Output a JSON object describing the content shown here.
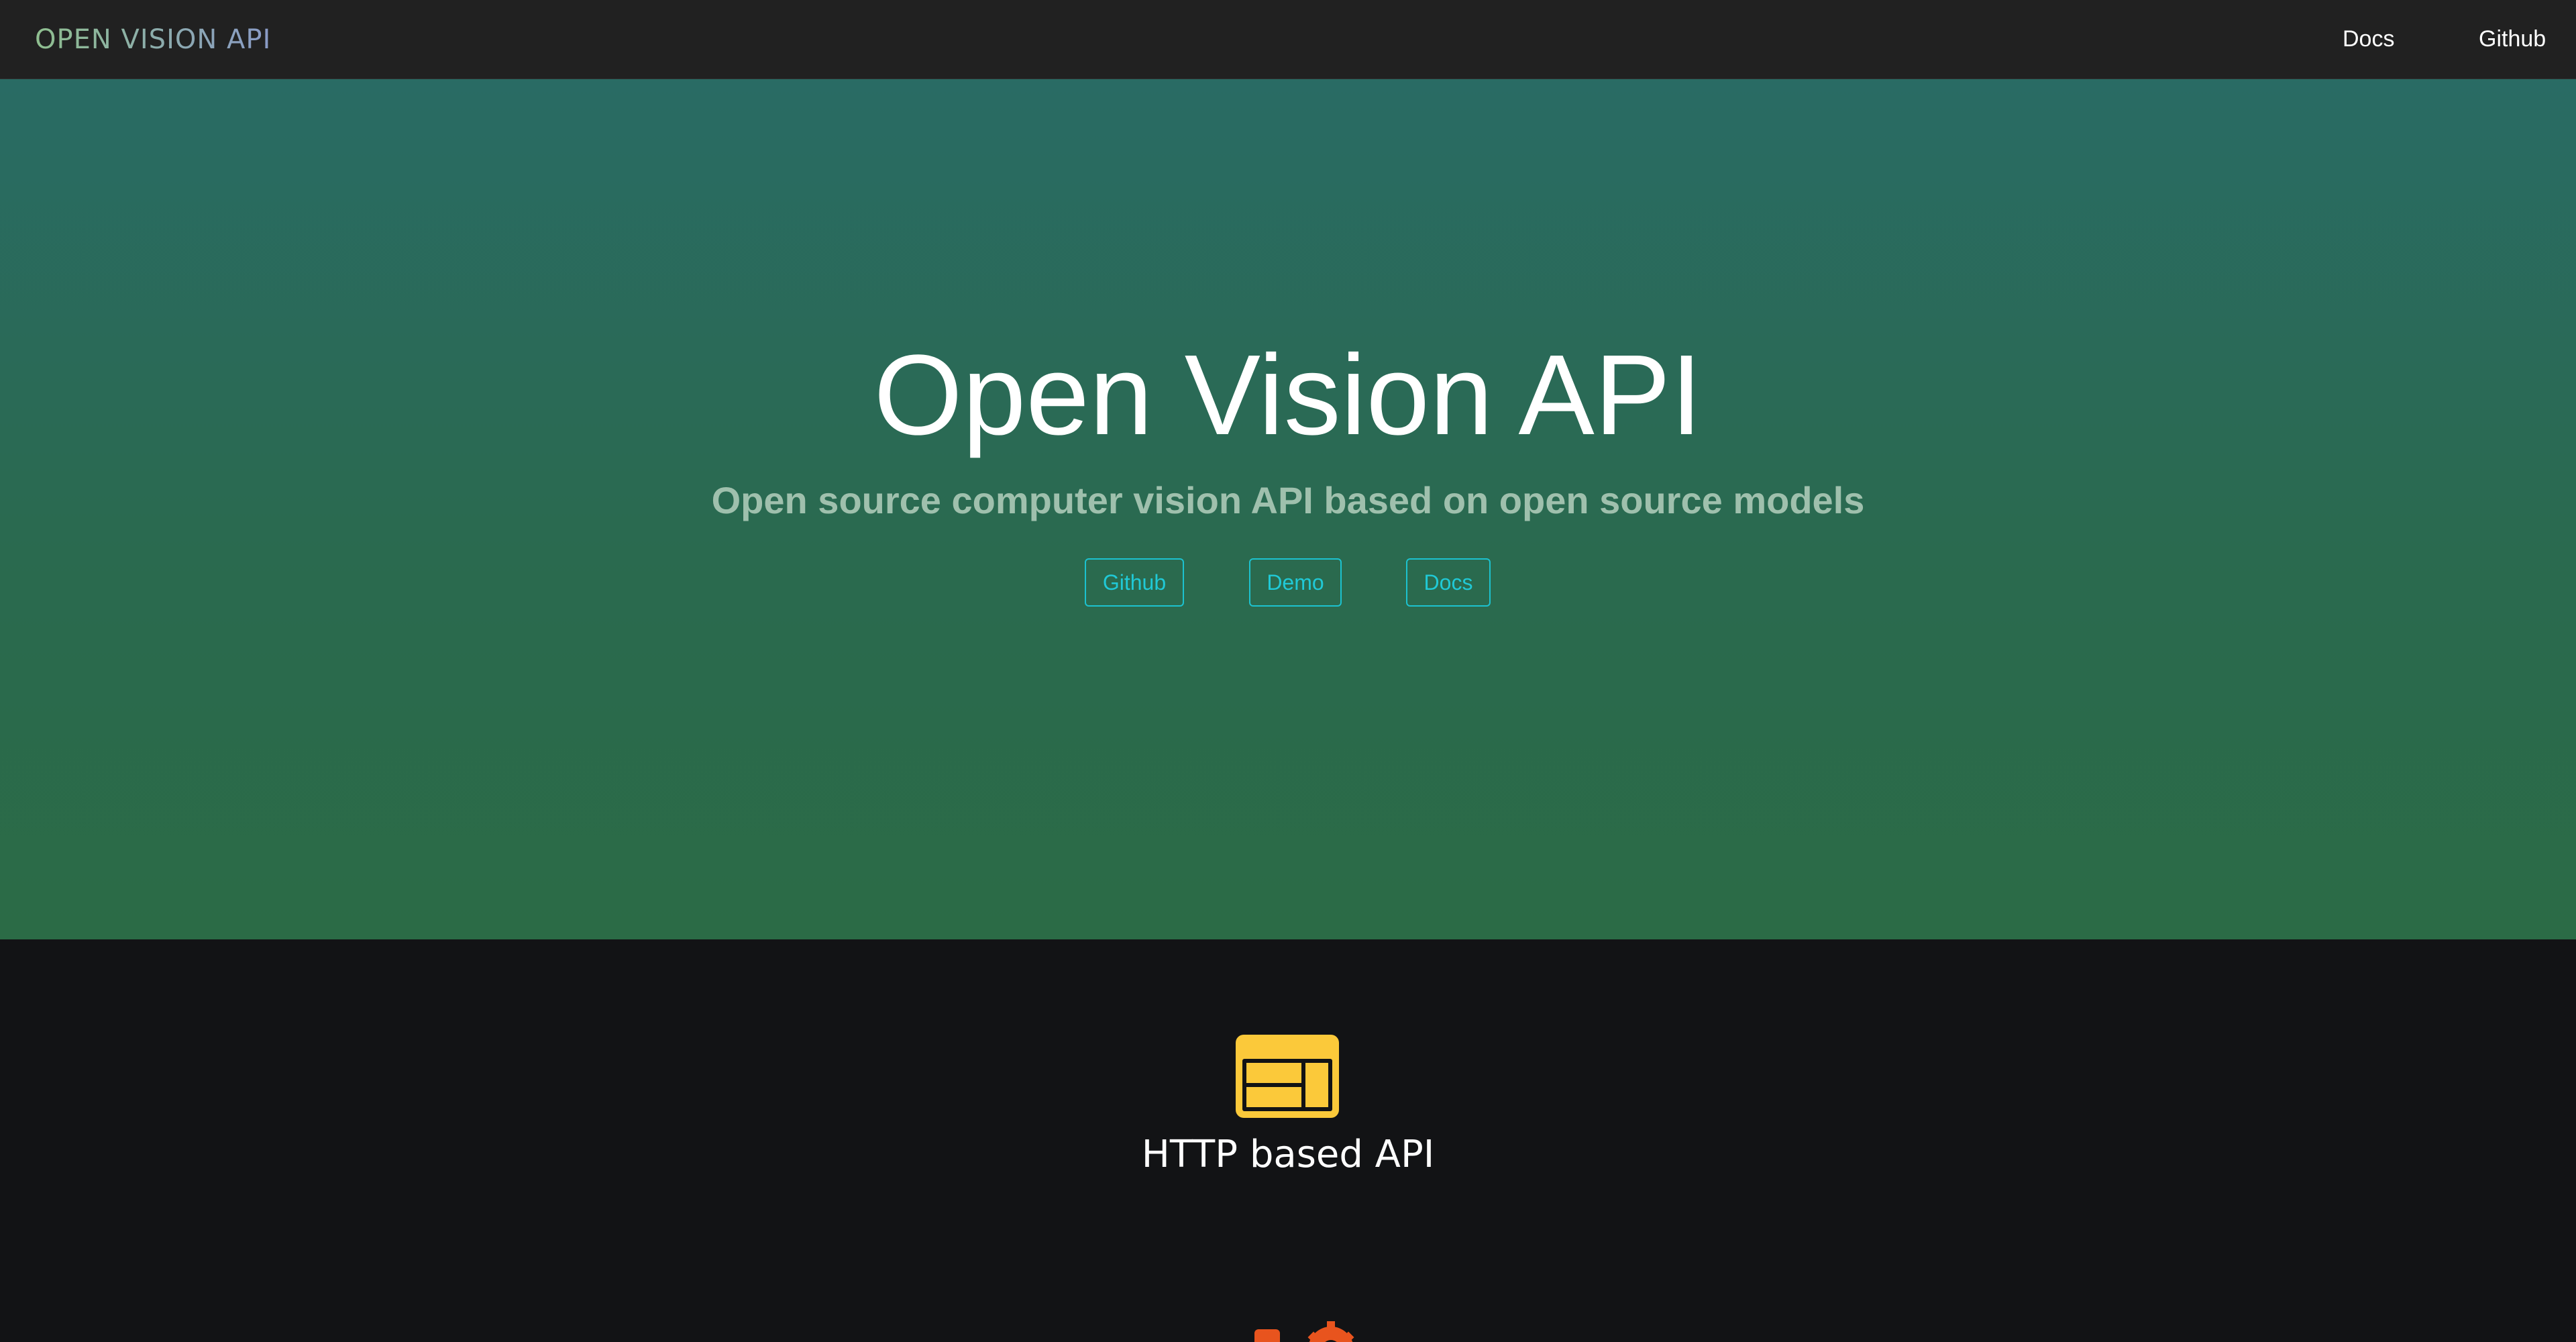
{
  "navbar": {
    "brand": "OPEN VISION API",
    "links": [
      {
        "label": "Docs"
      },
      {
        "label": "Github"
      }
    ]
  },
  "hero": {
    "title": "Open Vision API",
    "subtitle": "Open source computer vision API based on open source models",
    "buttons": [
      {
        "label": "Github"
      },
      {
        "label": "Demo"
      },
      {
        "label": "Docs"
      }
    ]
  },
  "features": [
    {
      "icon": "browser-window-icon",
      "title": "HTTP based API",
      "color": "#fbc93a"
    },
    {
      "icon": "user-gear-icon",
      "color": "#e8541e"
    }
  ],
  "colors": {
    "navbar_bg": "#212121",
    "hero_top": "#296b64",
    "hero_bottom": "#2b6b46",
    "button_accent": "#1cc2cf",
    "section_bg": "#121315"
  }
}
